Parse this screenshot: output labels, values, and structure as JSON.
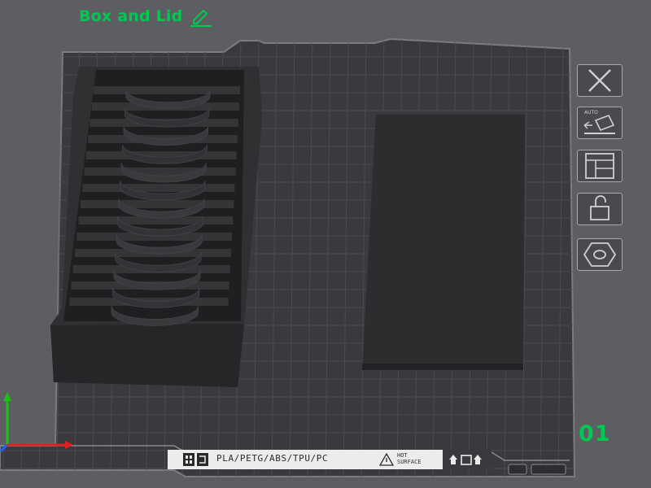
{
  "plate": {
    "title": "Box and Lid",
    "number": "01"
  },
  "bed_label": {
    "filaments": "PLA/PETG/ABS/TPU/PC",
    "hot_surface_line1": "HOT",
    "hot_surface_line2": "SURFACE"
  },
  "side_tools": [
    {
      "name": "delete-plate",
      "icon": "close-icon"
    },
    {
      "name": "auto-orient",
      "icon": "auto-orient-icon",
      "badge": "AUTO"
    },
    {
      "name": "arrange",
      "icon": "arrange-icon"
    },
    {
      "name": "lock-plate",
      "icon": "unlock-icon"
    },
    {
      "name": "plate-settings",
      "icon": "hex-nut-icon"
    }
  ],
  "colors": {
    "accent": "#00c853",
    "background": "#5e5e62",
    "bed": "#3a3a3e",
    "grid": "#4a4a50",
    "model": "#2b2b2d",
    "axis_x": "#e02020",
    "axis_y": "#18c018",
    "axis_z": "#2060ff"
  }
}
